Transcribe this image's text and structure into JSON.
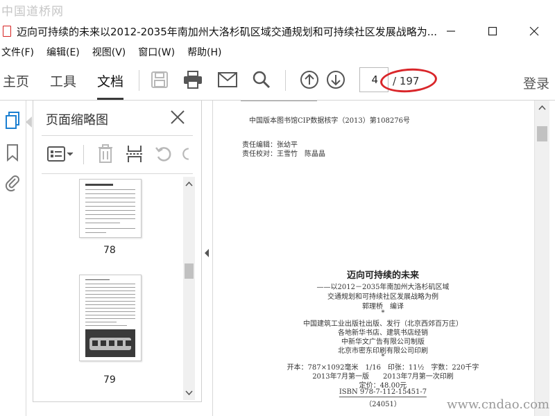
{
  "watermark": {
    "top": "中国道桥网",
    "bottom": "www.cndao.com"
  },
  "window": {
    "title": "迈向可持续的未来以2012-2035年南加州大洛杉矶区域交通规划和可持续社区发展战略为...",
    "minimize": "minimize",
    "maximize": "maximize",
    "close": "close"
  },
  "menu": [
    "文件(F)",
    "编辑(E)",
    "视图(V)",
    "窗口(W)",
    "帮助(H)"
  ],
  "toolbar": {
    "tabs": [
      "主页",
      "工具",
      "文档"
    ],
    "active_tab": "文档",
    "page_current": "4",
    "page_total": "/ 197",
    "login": "登录",
    "highlight_color": "#d9262a"
  },
  "left_rail": {
    "icons": [
      "pages-icon",
      "bookmark-icon",
      "attachment-icon"
    ],
    "active_color": "#1b7fd1"
  },
  "panel": {
    "title": "页面缩略图",
    "thumbnails": [
      {
        "label": "78"
      },
      {
        "label": "79"
      }
    ]
  },
  "document": {
    "line_cip": "中国版本图书馆CIP数据核字（2013）第108276号",
    "editor": "责任编辑：张幼平",
    "proofreader": "责任校对：王雪竹　陈晶晶",
    "book_title": "迈向可持续的未来",
    "subtitle_1": "——以2012－2035年南加州大洛杉矶区域",
    "subtitle_2": "交通规划和可持续社区发展战略为例",
    "translator": "郭理桥　编译",
    "star": "*",
    "publisher": "中国建筑工业出版社出版、发行（北京西郊百万庄）",
    "distributor": "各地新华书店、建筑书店经销",
    "typesetter": "中新华文广告有限公司制版",
    "printer": "北京市密东印刷有限公司印刷",
    "specs": "开本：787×1092毫米　1/16　印张：11½　字数：220千字",
    "edition": "2013年7月第一版　　2013年7月第一次印刷",
    "price": "定价：48.00元",
    "isbn": "ISBN 978-7-112-15451-7",
    "code": "（24051）"
  }
}
